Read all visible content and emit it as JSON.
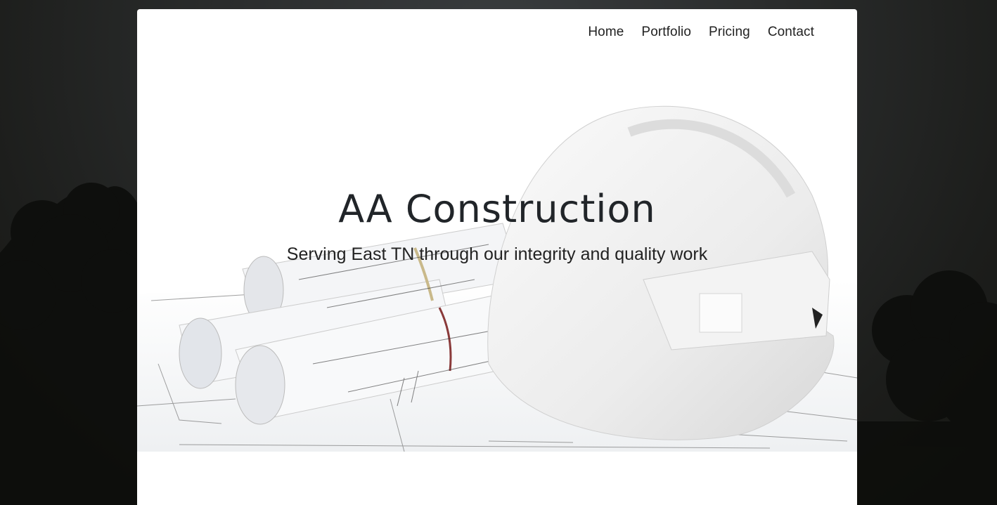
{
  "nav": {
    "items": [
      {
        "label": "Home"
      },
      {
        "label": "Portfolio"
      },
      {
        "label": "Pricing"
      },
      {
        "label": "Contact"
      }
    ]
  },
  "hero": {
    "title": "AA Construction",
    "subtitle": "Serving East TN through our integrity and quality work",
    "image": "hard-hat-and-blueprints"
  },
  "colors": {
    "page_background": "#1c1d1b",
    "card_background": "#ffffff",
    "text": "#212529"
  }
}
